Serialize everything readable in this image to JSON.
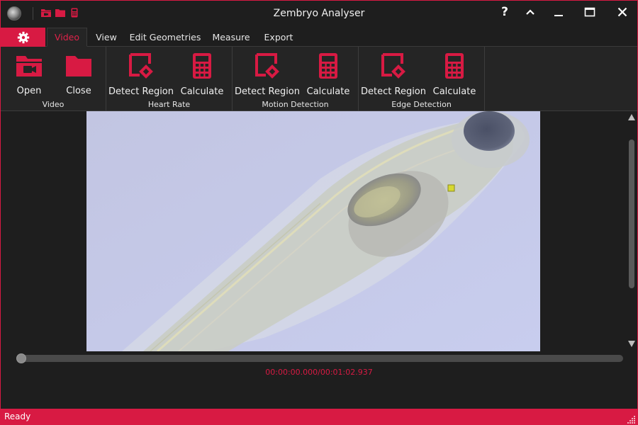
{
  "window": {
    "title": "Zembryo Analyser",
    "help_glyph": "?",
    "collapse_glyph": "^",
    "minimize_glyph": "—",
    "maximize_glyph": "☐",
    "close_glyph": "✕"
  },
  "quick_access": [
    {
      "icon": "open-video-icon"
    },
    {
      "icon": "folder-icon"
    },
    {
      "icon": "calculator-icon"
    }
  ],
  "tabs": [
    {
      "label": "Video",
      "active": true
    },
    {
      "label": "View"
    },
    {
      "label": "Edit Geometries"
    },
    {
      "label": "Measure"
    },
    {
      "label": "Export"
    }
  ],
  "ribbon": {
    "groups": [
      {
        "label": "Video",
        "buttons": [
          {
            "label": "Open",
            "icon": "open-video-icon"
          },
          {
            "label": "Close",
            "icon": "folder-icon"
          }
        ]
      },
      {
        "label": "Heart Rate",
        "buttons": [
          {
            "label": "Detect Region",
            "icon": "detect-region-icon"
          },
          {
            "label": "Calculate",
            "icon": "calculator-icon"
          }
        ]
      },
      {
        "label": "Motion Detection",
        "buttons": [
          {
            "label": "Detect Region",
            "icon": "detect-region-icon"
          },
          {
            "label": "Calculate",
            "icon": "calculator-icon"
          }
        ]
      },
      {
        "label": "Edge Detection",
        "buttons": [
          {
            "label": "Detect Region",
            "icon": "detect-region-icon"
          },
          {
            "label": "Calculate",
            "icon": "calculator-icon"
          }
        ]
      }
    ]
  },
  "player": {
    "timecode": "00:00:00.000/00:01:02.937",
    "position_fraction": 0.0
  },
  "status": {
    "text": "Ready"
  },
  "colors": {
    "accent": "#d81a43",
    "background": "#1e1e1e",
    "ribbon": "#252525"
  }
}
